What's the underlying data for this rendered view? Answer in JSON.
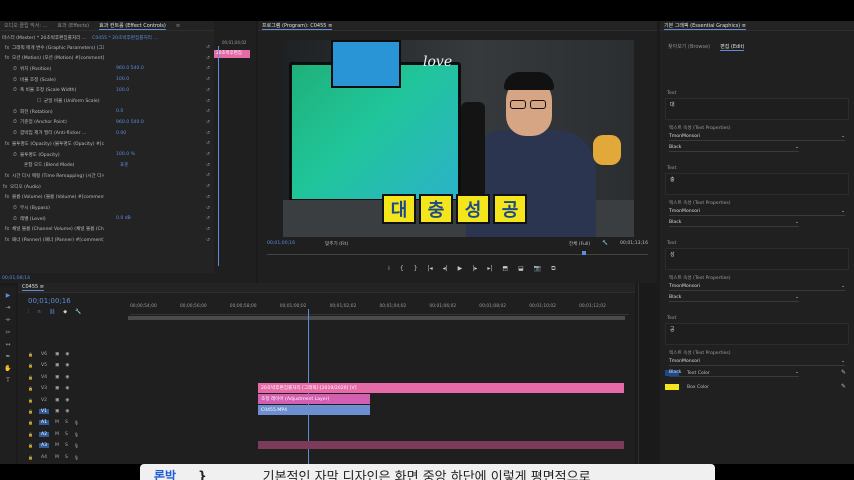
{
  "effect_controls": {
    "tabs": [
      "오디오 클립 믹서: ...",
      "효과 (Effects)",
      "효과 컨트롤 (Effect Controls)",
      "≡"
    ],
    "source": "마스터 (Master) * 20초박후편집률처리 ...",
    "sequence": "C0455 * 20초박후편집률처리 ...",
    "timecode_head": "00;01;04;02",
    "clip_label": "20초박후편집",
    "rows": [
      {
        "label": "그래픽 매개 변수 (Graphic Parameters) (그래픽 매개 변수 (Gra...",
        "value": ""
      },
      {
        "label": "모션 (Motion) (모션 (Motion) #[comment]component.name + cha...",
        "value": ""
      },
      {
        "label": "위치 (Position)",
        "value": "960.0    540.0"
      },
      {
        "label": "비율 조정 (Scale)",
        "value": "100.0"
      },
      {
        "label": "폭 비율 조정 (Scale Width)",
        "value": "100.0"
      },
      {
        "label": "균일 비율 (Uniform Scale)",
        "value": ""
      },
      {
        "label": "회전 (Rotation)",
        "value": "0.0"
      },
      {
        "label": "기준점 (Anchor Point)",
        "value": "960.0    540.0"
      },
      {
        "label": "깜박임 제거 필터 (Anti-flicker ...",
        "value": "0.00"
      },
      {
        "label": "불투명도 (Opacity) (불투명도 (Opacity) #[comment]component...",
        "value": ""
      },
      {
        "label": "불투명도 (Opacity)",
        "value": "100.0 %"
      },
      {
        "label": "혼합 모드 (Blend Mode)",
        "value": "표준"
      },
      {
        "label": "시간 다시 매핑 (Time Remapping) (시간 다시 매핑 (Time Rema...",
        "value": ""
      },
      {
        "label": "오디오 (Audio)",
        "value": ""
      },
      {
        "label": "볼륨 (Volume) (볼륨 (Volume) #[comment]component.name + ch...",
        "value": ""
      },
      {
        "label": "무시 (Bypass)",
        "value": ""
      },
      {
        "label": "레벨 (Level)",
        "value": "0.0 dB"
      },
      {
        "label": "채널 볼륨 (Channel Volume) (채널 볼륨 (Channel Volume) #[co...",
        "value": ""
      },
      {
        "label": "패너 (Panner) (패너 (Panner) #[comment]component.name + ch...",
        "value": ""
      }
    ],
    "bottom_timecode": "00;01;08;14"
  },
  "program": {
    "title": "프로그램 (Program): C0455  ≡",
    "overlay_text": "대충성공",
    "timecode": "00;01;00;16",
    "fit": "맞추기 (Fit)",
    "quality": "전체 (Full)",
    "duration": "00;01;13;16",
    "transport": [
      "⁞",
      "{",
      "}",
      "|◂",
      "◂|",
      "▶",
      "|▸",
      "▸|",
      "⬒",
      "⬓",
      "📷",
      "⧉"
    ]
  },
  "timeline": {
    "tab": "C0455  ≡",
    "timecode": "00;01;00;16",
    "ruler": [
      "00;00;54;00",
      "00;00;56;00",
      "00;00;58;00",
      "00;01;00;02",
      "00;01;02;02",
      "00;01;04;02",
      "00;01;06;02",
      "00;01;08;02",
      "00;01;10;02",
      "00;01;12;02"
    ],
    "video_tracks": [
      "V6",
      "V5",
      "V4",
      "V3",
      "V2",
      "V1"
    ],
    "audio_tracks": [
      "A1",
      "A2",
      "A3",
      "A4"
    ],
    "clips": {
      "title_clip": "20초박후편집률처리 [그래픽]·[2019/2020] [V]",
      "adjustment": "조정 레이어 (Adjustment Layer)",
      "video": "C0455.MP4"
    }
  },
  "essential_graphics": {
    "title": "기본 그래픽 (Essential Graphics)  ≡",
    "tabs": [
      "찾아보기 (Browse)",
      "편집 (Edit)"
    ],
    "text_blocks": [
      {
        "label": "Text",
        "value": "대",
        "prop_label": "텍스트 속성 (Text Properties)",
        "font": "TmonMonsori",
        "style": "Black"
      },
      {
        "label": "Text",
        "value": "충",
        "prop_label": "텍스트 속성 (Text Properties)",
        "font": "TmonMonsori",
        "style": "Black"
      },
      {
        "label": "Text",
        "value": "성",
        "prop_label": "텍스트 속성 (Text Properties)",
        "font": "TmonMonsori",
        "style": "Black"
      },
      {
        "label": "Text",
        "value": "공",
        "prop_label": "텍스트 속성 (Text Properties)",
        "font": "TmonMonsori",
        "style": "Black"
      }
    ],
    "text_color_label": "Text Color",
    "box_color_label": "Box Color",
    "text_color": "#1a4a8a",
    "box_color": "#f5e51b"
  },
  "subtitle": {
    "speaker": "론박",
    "brace": "}",
    "line": "기본적인 자막 디자인은 화면 중앙 하단에 이렇게 평면적으로"
  },
  "colors": {
    "accent": "#5b8ddb",
    "title_clip": "#e66aa8",
    "adjustment_clip": "#d35fb0",
    "video_clip": "#6c8fd1",
    "subtitle_speaker": "#1e5bd8"
  }
}
